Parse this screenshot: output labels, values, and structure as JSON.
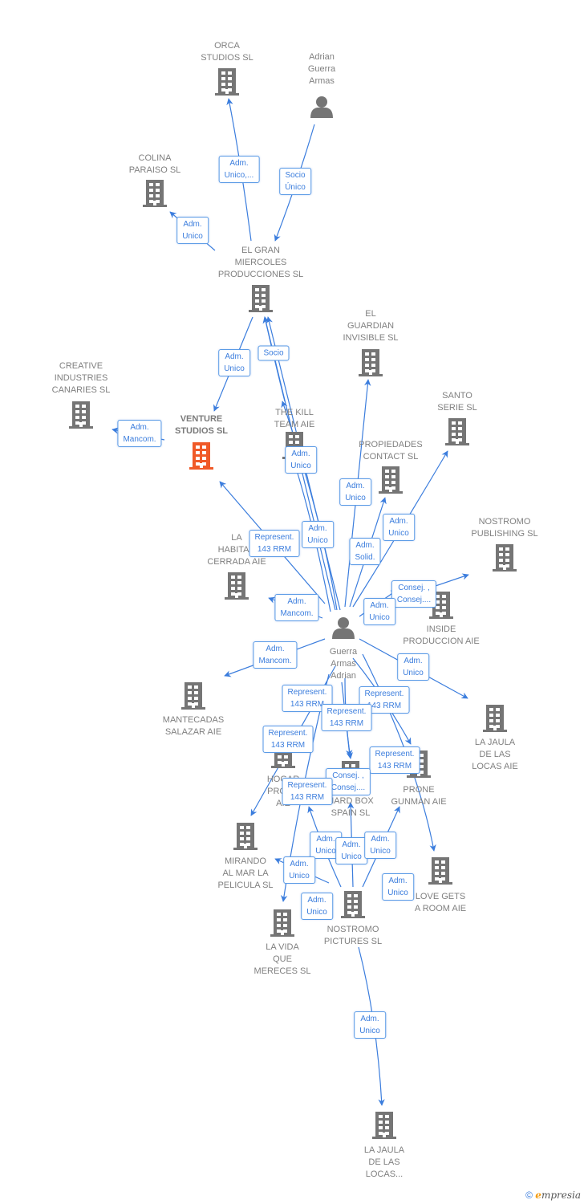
{
  "colors": {
    "edge": "#3b7ddd",
    "label_border": "#5b9be6",
    "node_text": "#808080",
    "icon": "#757575",
    "highlight": "#f05a28"
  },
  "nodes": [
    {
      "type": "company",
      "lines": [
        "ORCA",
        "STUDIOS  SL"
      ]
    },
    {
      "type": "person",
      "lines": [
        "Adrian",
        "Guerra",
        "Armas"
      ]
    },
    {
      "type": "company",
      "lines": [
        "COLINA",
        "PARAISO SL"
      ]
    },
    {
      "type": "company",
      "lines": [
        "EL GRAN",
        "MIERCOLES",
        "PRODUCCIONES SL"
      ]
    },
    {
      "type": "company",
      "lines": [
        "EL",
        "GUARDIAN",
        "INVISIBLE  SL"
      ]
    },
    {
      "type": "company",
      "lines": [
        "CREATIVE",
        "INDUSTRIES",
        "CANARIES  SL"
      ]
    },
    {
      "type": "company",
      "highlight": true,
      "lines": [
        "VENTURE",
        "STUDIOS  SL"
      ]
    },
    {
      "type": "company",
      "lines": [
        "THE KILL",
        "TEAM  AIE"
      ]
    },
    {
      "type": "company",
      "lines": [
        "SANTO",
        "SERIE  SL"
      ]
    },
    {
      "type": "company",
      "lines": [
        "PROPIEDADES",
        "CONTACT  SL"
      ]
    },
    {
      "type": "company",
      "lines": [
        "NOSTROMO",
        "PUBLISHING SL"
      ]
    },
    {
      "type": "company",
      "lines": [
        "LA",
        "HABITAC",
        "CERRADA  AIE"
      ]
    },
    {
      "type": "company",
      "lines": [
        "INSIDE",
        "PRODUCCION AIE"
      ]
    },
    {
      "type": "person",
      "lines": [
        "Guerra",
        "Armas",
        "Adrian"
      ]
    },
    {
      "type": "company",
      "lines": [
        "MANTECADAS",
        "SALAZAR  AIE"
      ]
    },
    {
      "type": "company",
      "lines": [
        "LA JAULA",
        "DE LAS",
        "LOCAS  AIE"
      ]
    },
    {
      "type": "company",
      "lines": [
        "HOGAR",
        "PRODU",
        "AIE"
      ]
    },
    {
      "type": "company",
      "lines": [
        "HARD BOX",
        "SPAIN  SL"
      ]
    },
    {
      "type": "company",
      "lines": [
        "PRONE",
        "GUNMAN AIE"
      ]
    },
    {
      "type": "company",
      "lines": [
        "MIRANDO",
        "AL MAR LA",
        "PELICULA  SL"
      ]
    },
    {
      "type": "company",
      "lines": [
        "LOVE GETS",
        "A ROOM AIE"
      ]
    },
    {
      "type": "company",
      "lines": [
        "LA VIDA",
        "QUE",
        "MERECES  SL"
      ]
    },
    {
      "type": "company",
      "lines": [
        "NOSTROMO",
        "PICTURES  SL"
      ]
    },
    {
      "type": "company",
      "lines": [
        "LA JAULA",
        "DE LAS",
        "LOCAS..."
      ]
    }
  ],
  "edge_labels": [
    {
      "lines": [
        "Adm.",
        "Unico,..."
      ]
    },
    {
      "lines": [
        "Socio",
        "Único"
      ]
    },
    {
      "lines": [
        "Adm.",
        "Unico"
      ]
    },
    {
      "lines": [
        "Adm.",
        "Unico"
      ]
    },
    {
      "lines": [
        "Socio"
      ]
    },
    {
      "lines": [
        "Adm.",
        "Mancom."
      ]
    },
    {
      "lines": [
        "Adm.",
        "Unico"
      ]
    },
    {
      "lines": [
        "Adm.",
        "Unico"
      ]
    },
    {
      "lines": [
        "Adm.",
        "Unico"
      ]
    },
    {
      "lines": [
        "Adm.",
        "Unico"
      ]
    },
    {
      "lines": [
        "Represent.",
        "143 RRM"
      ]
    },
    {
      "lines": [
        "Adm.",
        "Solid."
      ]
    },
    {
      "lines": [
        "Consej. ,",
        "Consej...."
      ]
    },
    {
      "lines": [
        "Adm.",
        "Mancom."
      ]
    },
    {
      "lines": [
        "Adm.",
        "Unico"
      ]
    },
    {
      "lines": [
        "Adm.",
        "Mancom."
      ]
    },
    {
      "lines": [
        "Adm.",
        "Unico"
      ]
    },
    {
      "lines": [
        "Represent.",
        "143 RRM"
      ]
    },
    {
      "lines": [
        "Represent.",
        "143 RRM"
      ]
    },
    {
      "lines": [
        "Represent.",
        "143 RRM"
      ]
    },
    {
      "lines": [
        "Represent.",
        "143 RRM"
      ]
    },
    {
      "lines": [
        "Represent.",
        "143 RRM"
      ]
    },
    {
      "lines": [
        "Consej. ,",
        "Consej...."
      ]
    },
    {
      "lines": [
        "Represent.",
        "143 RRM"
      ]
    },
    {
      "lines": [
        "Adm.",
        "Unico"
      ]
    },
    {
      "lines": [
        "Adm.",
        "Unico"
      ]
    },
    {
      "lines": [
        "Adm.",
        "Unico"
      ]
    },
    {
      "lines": [
        "Adm.",
        "Unico"
      ]
    },
    {
      "lines": [
        "Adm.",
        "Unico"
      ]
    },
    {
      "lines": [
        "Adm.",
        "Unico"
      ]
    },
    {
      "lines": [
        "Adm.",
        "Unico"
      ]
    }
  ],
  "footer": {
    "copyright": "©",
    "brand_initial": "e",
    "brand_rest": "mpresia"
  }
}
